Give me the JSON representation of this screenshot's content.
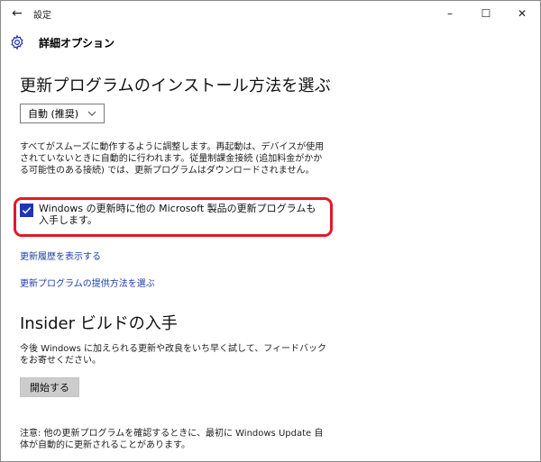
{
  "window": {
    "title": "設定",
    "controls": {
      "minimize": "–",
      "maximize": "☐",
      "close": "✕"
    }
  },
  "header": {
    "page_title": "詳細オプション"
  },
  "updates": {
    "heading": "更新プログラムのインストール方法を選ぶ",
    "install_mode": {
      "selected": "自動 (推奨)"
    },
    "description": "すべてがスムーズに動作するように調整します。再起動は、デバイスが使用されていないときに自動的に行われます。従量制課金接続 (追加料金がかかる可能性のある接続) では、更新プログラムはダウンロードされません。",
    "other_products_checkbox": {
      "label": "Windows の更新時に他の Microsoft 製品の更新プログラムも入手します。",
      "checked": true
    },
    "history_link": "更新履歴を表示する",
    "delivery_link": "更新プログラムの提供方法を選ぶ"
  },
  "insider": {
    "heading": "Insider ビルドの入手",
    "description": "今後 Windows に加えられる更新や改良をいち早く試して、フィードバックをお寄せください。",
    "start_button": "開始する"
  },
  "note": "注意: 他の更新プログラムを確認するときに、最初に Windows Update 自体が自動的に更新されることがあります。",
  "colors": {
    "accent": "#1c36b8",
    "link": "#1e3da8",
    "highlight": "#e0192a"
  },
  "icons": {
    "back": "back-arrow-icon",
    "settings": "gear-icon",
    "check": "checkmark-icon",
    "chevron": "chevron-down-icon"
  }
}
